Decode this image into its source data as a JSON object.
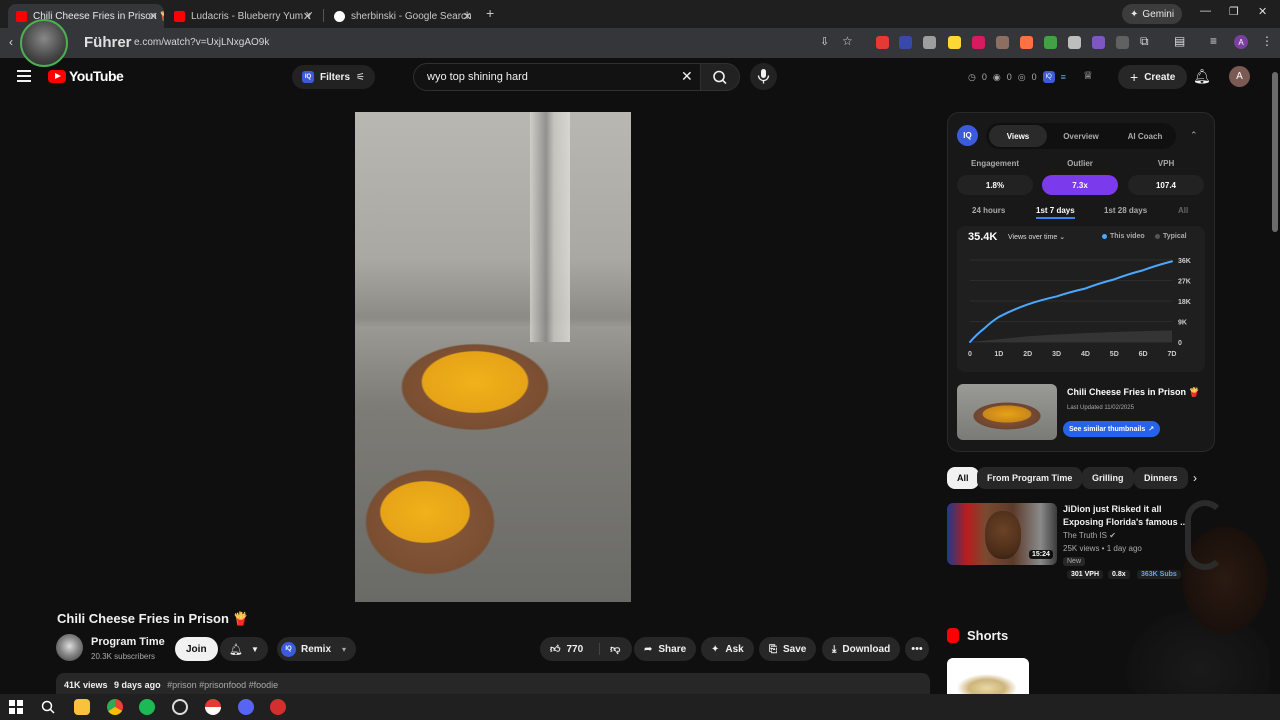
{
  "browser": {
    "tabs": [
      {
        "title": "Chili Cheese Fries in Prison 🍟",
        "active": true
      },
      {
        "title": "Ludacris - Blueberry Yum Y",
        "active": false
      },
      {
        "title": "sherbinski - Google Search",
        "active": false
      }
    ],
    "gemini_label": "Gemini",
    "url": "e.com/watch?v=UxjLNxgAO9k",
    "overlay_name": "Führer"
  },
  "header": {
    "logo_text": "YouTube",
    "filters_label": "Filters",
    "search_value": "wyo top shining hard",
    "stats": [
      "0",
      "0",
      "0"
    ],
    "create_label": "Create",
    "avatar_letter": "A"
  },
  "video": {
    "title": "Chili Cheese Fries in Prison 🍟",
    "channel_name": "Program Time",
    "channel_subs": "20.3K subscribers",
    "join_label": "Join",
    "remix_label": "Remix",
    "like_count": "770",
    "share_label": "Share",
    "ask_label": "Ask",
    "save_label": "Save",
    "download_label": "Download",
    "views": "41K views",
    "age": "9 days ago",
    "tags": "#prison #prisonfood #foodie"
  },
  "iq_panel": {
    "logo": "IQ",
    "tabs": [
      "Views",
      "Overview",
      "AI Coach"
    ],
    "metrics": [
      {
        "label": "Engagement",
        "value": "1.8%"
      },
      {
        "label": "Outlier",
        "value": "7.3x"
      },
      {
        "label": "VPH",
        "value": "107.4"
      }
    ],
    "periods": [
      "24 hours",
      "1st 7 days",
      "1st 28 days",
      "All"
    ],
    "chart_total": "35.4K",
    "chart_mode": "Views over time",
    "legend_this": "This video",
    "legend_typical": "Typical",
    "thumb_title": "Chili Cheese Fries in Prison 🍟",
    "thumb_updated": "Last Updated 11/02/2025",
    "similar_label": "See similar thumbnails"
  },
  "chart_data": {
    "type": "line",
    "x_ticks": [
      "0",
      "1D",
      "2D",
      "3D",
      "4D",
      "5D",
      "6D",
      "7D"
    ],
    "y_ticks": [
      "0",
      "9K",
      "18K",
      "27K",
      "36K"
    ],
    "ylim": [
      0,
      36000
    ],
    "xlim": [
      0,
      7
    ],
    "series": [
      {
        "name": "This video",
        "color": "#4aa8ff",
        "x": [
          0,
          0.5,
          1,
          2,
          3,
          4,
          5,
          6,
          7
        ],
        "y": [
          0,
          6000,
          11000,
          16500,
          20000,
          23500,
          27500,
          31500,
          35400
        ]
      },
      {
        "name": "Typical",
        "color": "#555555",
        "x": [
          0,
          1,
          2,
          3,
          4,
          5,
          6,
          7
        ],
        "y": [
          0,
          1200,
          2500,
          3300,
          3900,
          4400,
          4800,
          5100
        ]
      }
    ],
    "grid": true,
    "legend": "top-right"
  },
  "chips": [
    "All",
    "From Program Time",
    "Grilling",
    "Dinners"
  ],
  "recommendation": {
    "title": "JiDion just Risked it all Exposing Florida's famous ...",
    "channel": "The Truth IS",
    "meta": "25K views • 1 day ago",
    "badge": "New",
    "duration": "15:24",
    "stats": [
      "301 VPH",
      "0.8x",
      "363K Subs"
    ]
  },
  "shorts_title": "Shorts"
}
